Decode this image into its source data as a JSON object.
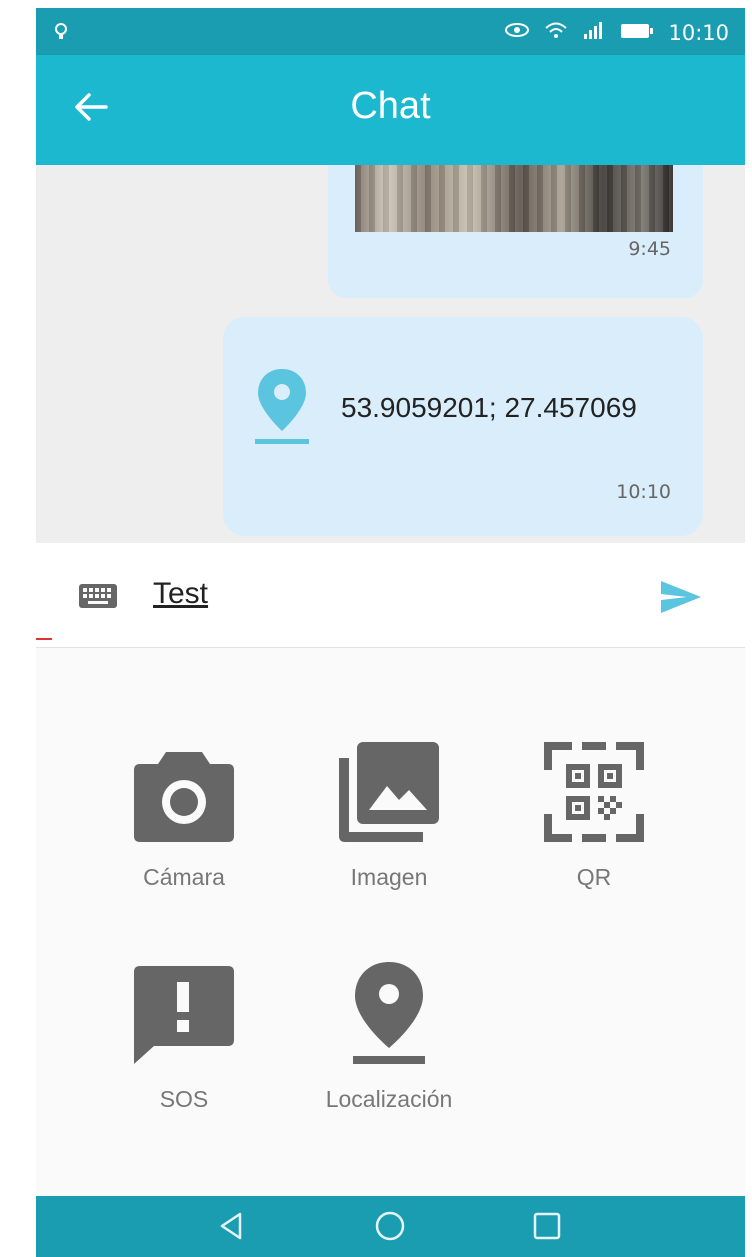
{
  "status_bar": {
    "time": "10:10",
    "icons": [
      "notification-icon",
      "eye-icon",
      "wifi-icon",
      "signal-icon",
      "battery-icon"
    ]
  },
  "app_bar": {
    "title": "Chat",
    "back_icon": "arrow-left-icon"
  },
  "messages": [
    {
      "type": "image",
      "time": "9:45"
    },
    {
      "type": "location",
      "icon": "location-pin-icon",
      "coords": "53.9059201; 27.457069",
      "time": "10:10"
    }
  ],
  "composer": {
    "value": "Test",
    "keyboard_icon": "keyboard-icon",
    "send_icon": "send-icon"
  },
  "attachments": [
    {
      "label": "Cámara",
      "icon": "camera-icon"
    },
    {
      "label": "Imagen",
      "icon": "image-gallery-icon"
    },
    {
      "label": "QR",
      "icon": "qr-code-icon"
    },
    {
      "label": "SOS",
      "icon": "alert-message-icon"
    },
    {
      "label": "Localización",
      "icon": "location-pin-icon"
    }
  ],
  "nav_bar": {
    "icons": [
      "nav-back-icon",
      "nav-home-icon",
      "nav-recents-icon"
    ]
  },
  "colors": {
    "status_bar": "#1a9db0",
    "app_bar": "#1bb8cf",
    "bubble": "#d9edfa",
    "accent": "#5bc4de",
    "icon_gray": "#666666"
  }
}
